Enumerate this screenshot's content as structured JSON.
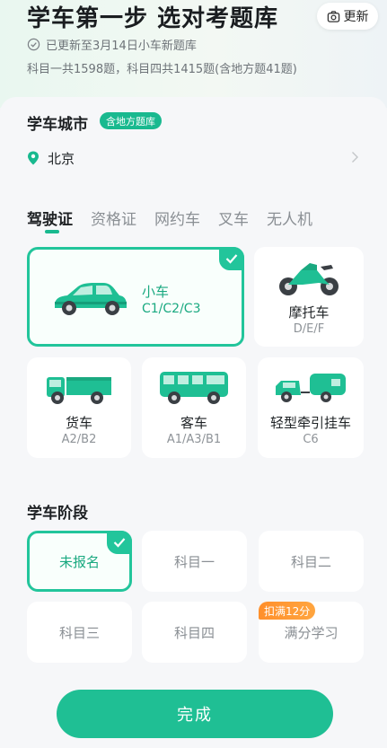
{
  "header": {
    "title": "学车第一步 选对考题库",
    "update_button": "更新",
    "update_status": "已更新至3月14日小车新题库",
    "question_counts": "科目一共1598题，科目四共1415题(含地方题41题)"
  },
  "city": {
    "section_title": "学车城市",
    "badge": "含地方题库",
    "value": "北京"
  },
  "license_tabs": [
    "驾驶证",
    "资格证",
    "网约车",
    "叉车",
    "无人机"
  ],
  "vehicles": [
    {
      "name": "小车",
      "codes": "C1/C2/C3",
      "selected": true
    },
    {
      "name": "摩托车",
      "codes": "D/E/F",
      "selected": false
    },
    {
      "name": "货车",
      "codes": "A2/B2",
      "selected": false
    },
    {
      "name": "客车",
      "codes": "A1/A3/B1",
      "selected": false
    },
    {
      "name": "轻型牵引挂车",
      "codes": "C6",
      "selected": false
    }
  ],
  "stage": {
    "section_title": "学车阶段",
    "options": [
      "未报名",
      "科目一",
      "科目二",
      "科目三",
      "科目四",
      "满分学习"
    ],
    "selected": "未报名",
    "badge": "扣满12分"
  },
  "done_button": "完成",
  "colors": {
    "accent": "#1fbf94",
    "badge_orange": "#ff9a35"
  }
}
